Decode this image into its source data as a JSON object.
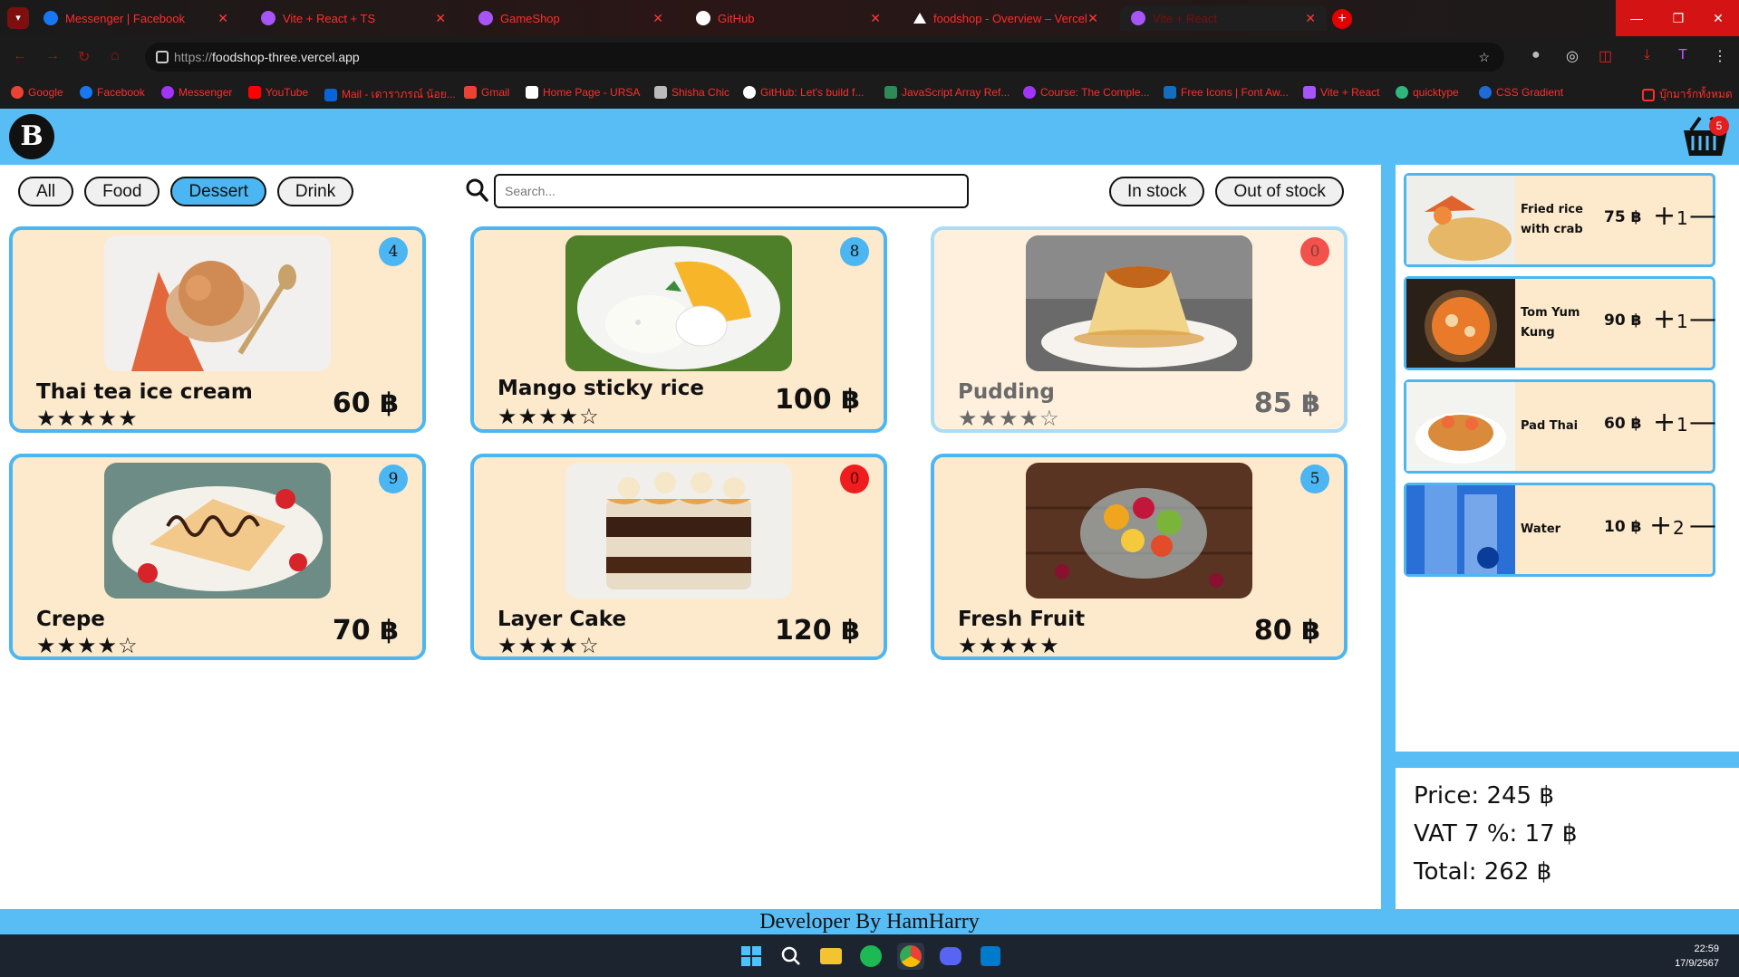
{
  "browser": {
    "tabs": [
      {
        "title": "Messenger | Facebook",
        "icon": "facebook-icon",
        "color": "#1877f2"
      },
      {
        "title": "Vite + React + TS",
        "icon": "vite-icon",
        "color": "#a855f7"
      },
      {
        "title": "GameShop",
        "icon": "vite-icon",
        "color": "#a855f7"
      },
      {
        "title": "GitHub",
        "icon": "github-icon",
        "color": "#ffffff"
      },
      {
        "title": "foodshop - Overview – Vercel",
        "icon": "vercel-icon",
        "color": "#ffffff"
      },
      {
        "title": "Vite + React",
        "icon": "vite-icon",
        "color": "#a855f7"
      }
    ],
    "url_scheme": "https://",
    "url_host": "foodshop-three.vercel.app",
    "bookmarks": [
      {
        "label": "Google",
        "color": "#ea4335"
      },
      {
        "label": "Facebook",
        "color": "#1877f2"
      },
      {
        "label": "Messenger",
        "color": "#a334fa"
      },
      {
        "label": "YouTube",
        "color": "#ff0000"
      },
      {
        "label": "Mail - เดาราภรณ์ น้อย...",
        "color": "#0a64d8"
      },
      {
        "label": "Gmail",
        "color": "#ea4335"
      },
      {
        "label": "Home Page - URSA",
        "color": "#ffffff"
      },
      {
        "label": "Shisha Chic",
        "color": "#bbbbbb"
      },
      {
        "label": "GitHub: Let's build f...",
        "color": "#ffffff"
      },
      {
        "label": "JavaScript Array Ref...",
        "color": "#2e8b57"
      },
      {
        "label": "Course: The Comple...",
        "color": "#a334fa"
      },
      {
        "label": "Free Icons | Font Aw...",
        "color": "#146ebe"
      },
      {
        "label": "Vite + React",
        "color": "#a855f7"
      },
      {
        "label": "quicktype",
        "color": "#2fb67c"
      },
      {
        "label": "CSS Gradient",
        "color": "#1e6bd6"
      },
      {
        "label": "บุ๊กมาร์กทั้งหมด",
        "color": "#ff2d2d"
      }
    ]
  },
  "header": {
    "logo_letter": "B",
    "cart_count": "5"
  },
  "filters": {
    "categories": [
      "All",
      "Food",
      "Dessert",
      "Drink"
    ],
    "active": "Dessert",
    "stock": [
      "In stock",
      "Out of stock"
    ]
  },
  "search": {
    "placeholder": "Search..."
  },
  "products": [
    {
      "name": "Thai tea ice cream",
      "price": "60 ฿",
      "qty": "4",
      "stars": "★★★★★",
      "rating": 5,
      "image": "thai-tea-ice-cream-photo",
      "in_stock": true
    },
    {
      "name": "Mango sticky rice",
      "price": "100 ฿",
      "qty": "8",
      "stars": "★★★★☆",
      "rating": 4,
      "image": "mango-sticky-rice-photo",
      "in_stock": true
    },
    {
      "name": "Pudding",
      "price": "85 ฿",
      "qty": "0",
      "stars": "★★★★☆",
      "rating": 4,
      "image": "pudding-photo",
      "in_stock": false
    },
    {
      "name": "Crepe",
      "price": "70 ฿",
      "qty": "9",
      "stars": "★★★★☆",
      "rating": 4,
      "image": "crepe-photo",
      "in_stock": true
    },
    {
      "name": "Layer Cake",
      "price": "120 ฿",
      "qty": "0",
      "stars": "★★★★☆",
      "rating": 4,
      "image": "layer-cake-photo",
      "in_stock": true
    },
    {
      "name": "Fresh Fruit",
      "price": "80 ฿",
      "qty": "5",
      "stars": "★★★★★",
      "rating": 5,
      "image": "fresh-fruit-photo",
      "in_stock": true
    }
  ],
  "cart": {
    "items": [
      {
        "name": "Fried rice with crab",
        "price": "75 ฿",
        "qty": "1",
        "image": "fried-rice-photo"
      },
      {
        "name": "Tom Yum Kung",
        "price": "90 ฿",
        "qty": "1",
        "image": "tom-yum-photo"
      },
      {
        "name": "Pad Thai",
        "price": "60 ฿",
        "qty": "1",
        "image": "pad-thai-photo"
      },
      {
        "name": "Water",
        "price": "10 ฿",
        "qty": "2",
        "image": "water-photo"
      }
    ],
    "plus": "+",
    "minus": "—",
    "price_line": "Price: 245 ฿",
    "vat_line": "VAT 7 %: 17 ฿",
    "total_line": "Total: 262 ฿"
  },
  "footer": {
    "text": "Developer By HamHarry"
  },
  "taskbar": {
    "time": "22:59",
    "date": "17/9/2567"
  },
  "colors": {
    "accent": "#58bdf5",
    "card_bg": "#fde9cc",
    "out_badge": "#ef1d1d"
  }
}
